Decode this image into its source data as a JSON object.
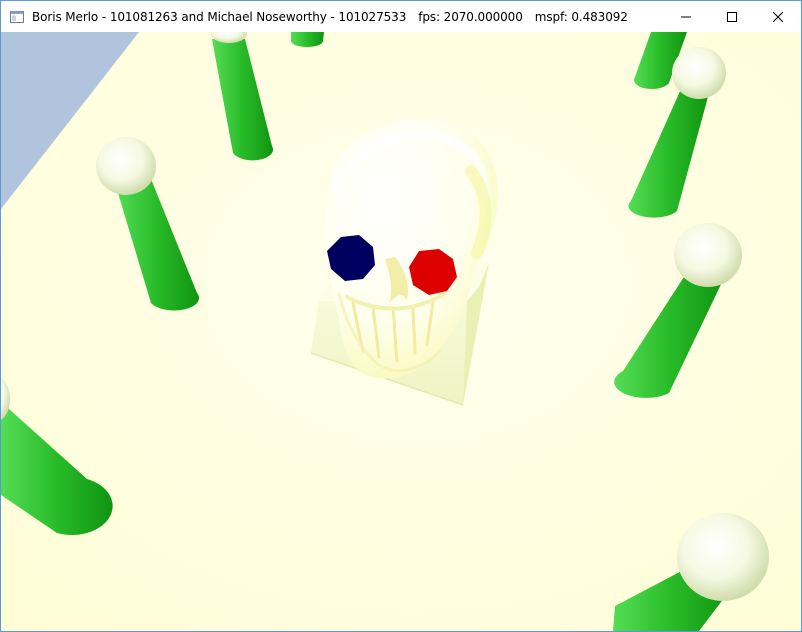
{
  "window": {
    "author_names": "Boris Merlo - 101081263 and Michael Noseworthy - 101027533",
    "fps_text": "fps: 2070.000000",
    "mspf_text": "mspf: 0.483092",
    "icon": "app-window-icon",
    "controls": {
      "minimize_icon": "minimize-icon",
      "maximize_icon": "maximize-icon",
      "close_icon": "close-icon"
    }
  },
  "scene": {
    "floor_color": "#ffffe0",
    "sky_color": "#b0c4de",
    "pillar_color": "#22b422",
    "sphere_color": "#f2f6d2",
    "skull_color": "#ffffe8",
    "left_eye_color": "#000060",
    "right_eye_color": "#dd0000"
  }
}
